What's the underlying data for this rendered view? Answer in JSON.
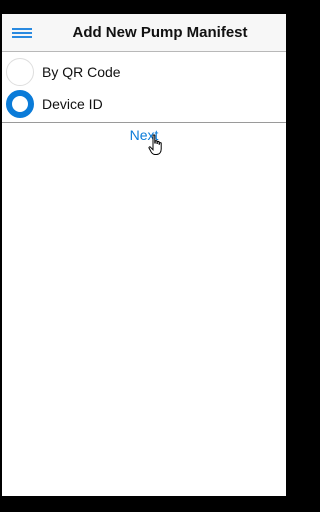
{
  "header": {
    "title": "Add New Pump Manifest",
    "menu_icon": "hamburger-menu-icon",
    "accent_color": "#0a7bd8"
  },
  "options": [
    {
      "label": "By QR Code",
      "selected": false
    },
    {
      "label": "Device ID",
      "selected": true
    }
  ],
  "actions": {
    "next_label": "Next"
  },
  "cursor": {
    "icon": "hand-pointer-icon"
  }
}
